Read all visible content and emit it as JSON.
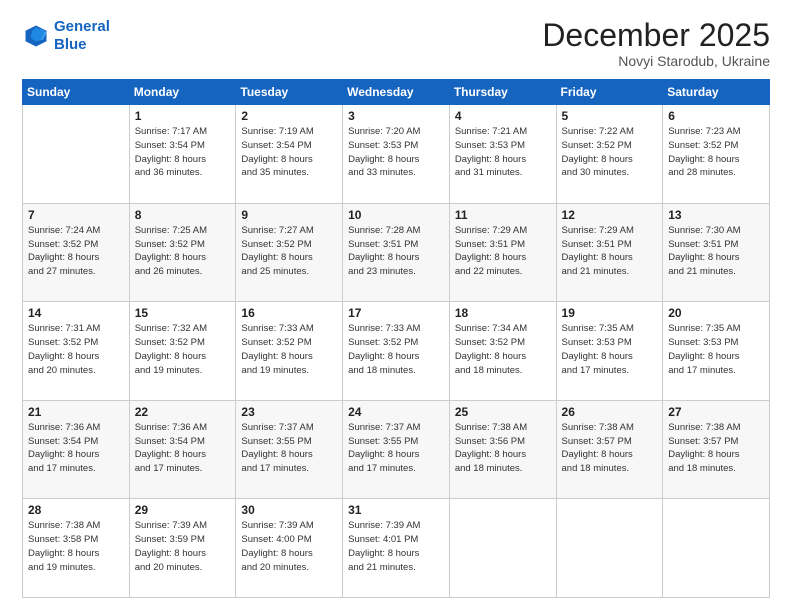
{
  "logo": {
    "line1": "General",
    "line2": "Blue"
  },
  "header": {
    "month": "December 2025",
    "location": "Novyi Starodub, Ukraine"
  },
  "weekdays": [
    "Sunday",
    "Monday",
    "Tuesday",
    "Wednesday",
    "Thursday",
    "Friday",
    "Saturday"
  ],
  "weeks": [
    [
      {
        "day": "",
        "info": ""
      },
      {
        "day": "1",
        "info": "Sunrise: 7:17 AM\nSunset: 3:54 PM\nDaylight: 8 hours\nand 36 minutes."
      },
      {
        "day": "2",
        "info": "Sunrise: 7:19 AM\nSunset: 3:54 PM\nDaylight: 8 hours\nand 35 minutes."
      },
      {
        "day": "3",
        "info": "Sunrise: 7:20 AM\nSunset: 3:53 PM\nDaylight: 8 hours\nand 33 minutes."
      },
      {
        "day": "4",
        "info": "Sunrise: 7:21 AM\nSunset: 3:53 PM\nDaylight: 8 hours\nand 31 minutes."
      },
      {
        "day": "5",
        "info": "Sunrise: 7:22 AM\nSunset: 3:52 PM\nDaylight: 8 hours\nand 30 minutes."
      },
      {
        "day": "6",
        "info": "Sunrise: 7:23 AM\nSunset: 3:52 PM\nDaylight: 8 hours\nand 28 minutes."
      }
    ],
    [
      {
        "day": "7",
        "info": "Sunrise: 7:24 AM\nSunset: 3:52 PM\nDaylight: 8 hours\nand 27 minutes."
      },
      {
        "day": "8",
        "info": "Sunrise: 7:25 AM\nSunset: 3:52 PM\nDaylight: 8 hours\nand 26 minutes."
      },
      {
        "day": "9",
        "info": "Sunrise: 7:27 AM\nSunset: 3:52 PM\nDaylight: 8 hours\nand 25 minutes."
      },
      {
        "day": "10",
        "info": "Sunrise: 7:28 AM\nSunset: 3:51 PM\nDaylight: 8 hours\nand 23 minutes."
      },
      {
        "day": "11",
        "info": "Sunrise: 7:29 AM\nSunset: 3:51 PM\nDaylight: 8 hours\nand 22 minutes."
      },
      {
        "day": "12",
        "info": "Sunrise: 7:29 AM\nSunset: 3:51 PM\nDaylight: 8 hours\nand 21 minutes."
      },
      {
        "day": "13",
        "info": "Sunrise: 7:30 AM\nSunset: 3:51 PM\nDaylight: 8 hours\nand 21 minutes."
      }
    ],
    [
      {
        "day": "14",
        "info": "Sunrise: 7:31 AM\nSunset: 3:52 PM\nDaylight: 8 hours\nand 20 minutes."
      },
      {
        "day": "15",
        "info": "Sunrise: 7:32 AM\nSunset: 3:52 PM\nDaylight: 8 hours\nand 19 minutes."
      },
      {
        "day": "16",
        "info": "Sunrise: 7:33 AM\nSunset: 3:52 PM\nDaylight: 8 hours\nand 19 minutes."
      },
      {
        "day": "17",
        "info": "Sunrise: 7:33 AM\nSunset: 3:52 PM\nDaylight: 8 hours\nand 18 minutes."
      },
      {
        "day": "18",
        "info": "Sunrise: 7:34 AM\nSunset: 3:52 PM\nDaylight: 8 hours\nand 18 minutes."
      },
      {
        "day": "19",
        "info": "Sunrise: 7:35 AM\nSunset: 3:53 PM\nDaylight: 8 hours\nand 17 minutes."
      },
      {
        "day": "20",
        "info": "Sunrise: 7:35 AM\nSunset: 3:53 PM\nDaylight: 8 hours\nand 17 minutes."
      }
    ],
    [
      {
        "day": "21",
        "info": "Sunrise: 7:36 AM\nSunset: 3:54 PM\nDaylight: 8 hours\nand 17 minutes."
      },
      {
        "day": "22",
        "info": "Sunrise: 7:36 AM\nSunset: 3:54 PM\nDaylight: 8 hours\nand 17 minutes."
      },
      {
        "day": "23",
        "info": "Sunrise: 7:37 AM\nSunset: 3:55 PM\nDaylight: 8 hours\nand 17 minutes."
      },
      {
        "day": "24",
        "info": "Sunrise: 7:37 AM\nSunset: 3:55 PM\nDaylight: 8 hours\nand 17 minutes."
      },
      {
        "day": "25",
        "info": "Sunrise: 7:38 AM\nSunset: 3:56 PM\nDaylight: 8 hours\nand 18 minutes."
      },
      {
        "day": "26",
        "info": "Sunrise: 7:38 AM\nSunset: 3:57 PM\nDaylight: 8 hours\nand 18 minutes."
      },
      {
        "day": "27",
        "info": "Sunrise: 7:38 AM\nSunset: 3:57 PM\nDaylight: 8 hours\nand 18 minutes."
      }
    ],
    [
      {
        "day": "28",
        "info": "Sunrise: 7:38 AM\nSunset: 3:58 PM\nDaylight: 8 hours\nand 19 minutes."
      },
      {
        "day": "29",
        "info": "Sunrise: 7:39 AM\nSunset: 3:59 PM\nDaylight: 8 hours\nand 20 minutes."
      },
      {
        "day": "30",
        "info": "Sunrise: 7:39 AM\nSunset: 4:00 PM\nDaylight: 8 hours\nand 20 minutes."
      },
      {
        "day": "31",
        "info": "Sunrise: 7:39 AM\nSunset: 4:01 PM\nDaylight: 8 hours\nand 21 minutes."
      },
      {
        "day": "",
        "info": ""
      },
      {
        "day": "",
        "info": ""
      },
      {
        "day": "",
        "info": ""
      }
    ]
  ]
}
